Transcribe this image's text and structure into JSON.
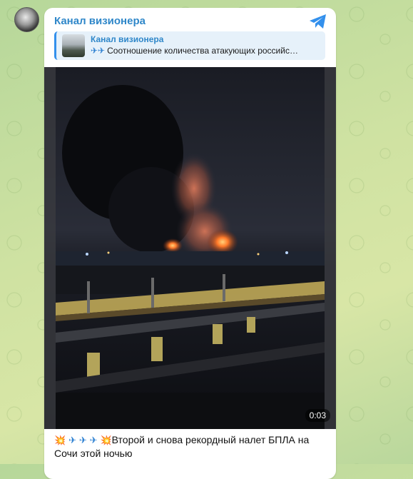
{
  "chat": {
    "channel_name": "Канал визионера",
    "reply": {
      "title": "Канал визионера",
      "text_icons": "✈✈",
      "text": "Соотношение количества атакующих российс…"
    },
    "video": {
      "duration": "0:03"
    },
    "caption": {
      "emoji_prefix": [
        "💥",
        "✈",
        "✈",
        "✈",
        "💥"
      ],
      "text": "Второй и снова рекордный налет БПЛА на Сочи этой ночью"
    }
  },
  "colors": {
    "link_blue": "#2f87c9",
    "telegram_blue": "#3390ec",
    "bubble_bg": "#ffffff",
    "background_green": "#c6dea0"
  },
  "icons": {
    "telegram": "telegram-logo-icon",
    "avatar": "channel-avatar"
  }
}
